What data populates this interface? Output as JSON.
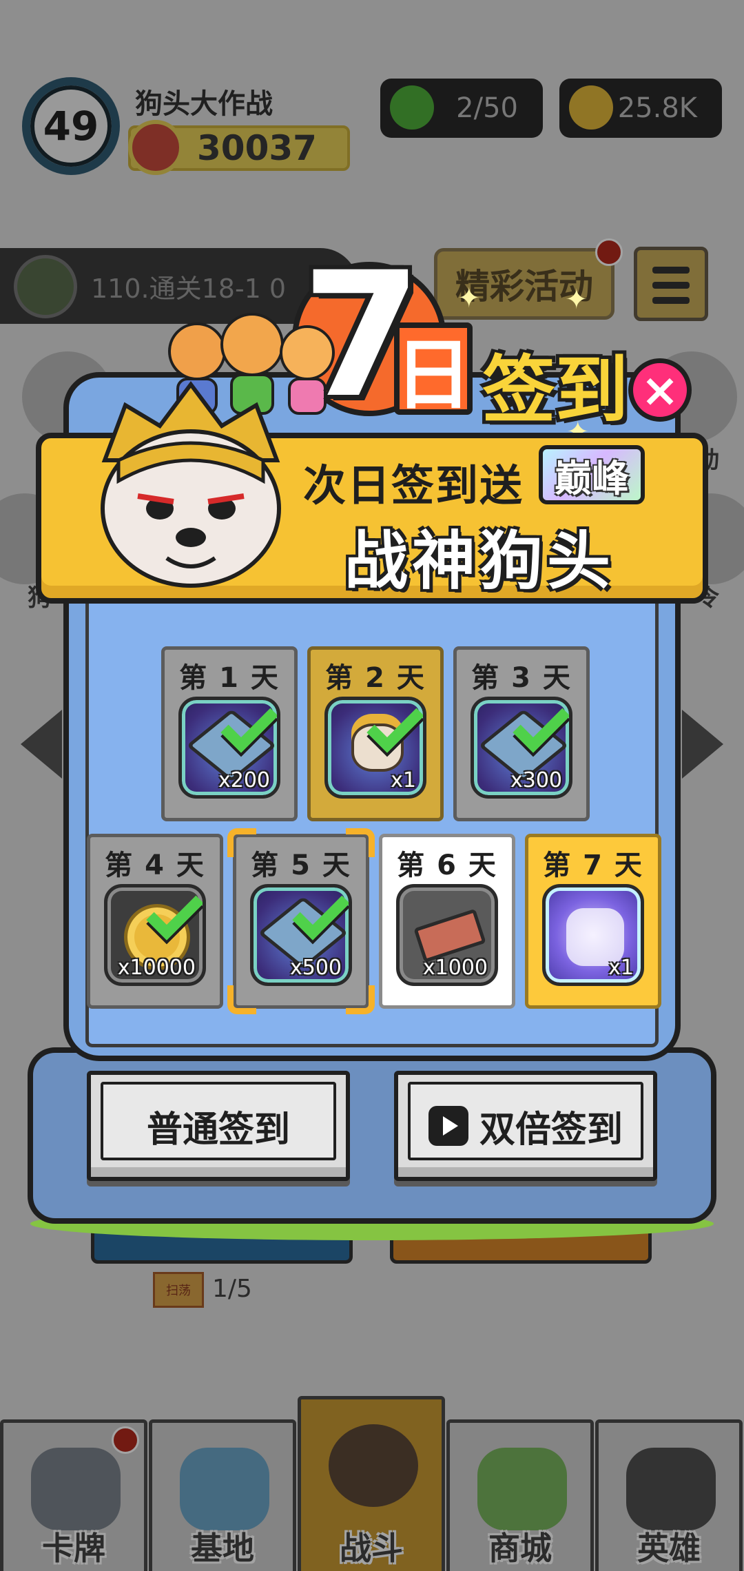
{
  "header": {
    "level": "49",
    "game_name": "狗头大作战",
    "power": "30037",
    "energy": "2/50",
    "coins": "25.8K"
  },
  "quest": {
    "text": "110.通关18-1  0"
  },
  "activity_button": "精彩活动",
  "sweep": {
    "ticket_label": "扫荡",
    "count": "1/5"
  },
  "bottom_nav": {
    "tabs": [
      {
        "label": "卡牌",
        "icon": "dog-card-icon"
      },
      {
        "label": "基地",
        "icon": "castle-icon"
      },
      {
        "label": "战斗",
        "icon": "paw-icon"
      },
      {
        "label": "商城",
        "icon": "cash-icon"
      },
      {
        "label": "英雄",
        "icon": "hero-dog-icon"
      }
    ],
    "active_index": 2
  },
  "side_labels": {
    "left": "狗",
    "right_top": "动",
    "right_bottom": "令"
  },
  "dialog": {
    "title_number": "7",
    "title_day": "日",
    "title_sign": "签到",
    "close_symbol": "×",
    "banner_line1": "次日签到送",
    "banner_tag": "巅峰",
    "banner_line2": "战神狗头",
    "days": [
      {
        "label": "第 1 天",
        "qty": "x200",
        "reward": "gem-icon",
        "claimed": true
      },
      {
        "label": "第 2 天",
        "qty": "x1",
        "reward": "hero-face-icon",
        "claimed": true
      },
      {
        "label": "第 3 天",
        "qty": "x300",
        "reward": "gem-icon",
        "claimed": true
      },
      {
        "label": "第 4 天",
        "qty": "x10000",
        "reward": "coin-icon",
        "claimed": true
      },
      {
        "label": "第 5 天",
        "qty": "x500",
        "reward": "gem-icon",
        "claimed": true
      },
      {
        "label": "第 6 天",
        "qty": "x1000",
        "reward": "brick-icon",
        "claimed": false
      },
      {
        "label": "第 7 天",
        "qty": "x1",
        "reward": "hero-silhouette-icon",
        "claimed": false
      }
    ],
    "normal_signin": "普通签到",
    "double_signin": "双倍签到"
  },
  "colors": {
    "accent_yellow": "#f6c233",
    "dialog_blue": "#7aa6e0",
    "close_pink": "#ff2f7a",
    "check_green": "#4fd14a",
    "title_orange": "#ff6a2c"
  }
}
